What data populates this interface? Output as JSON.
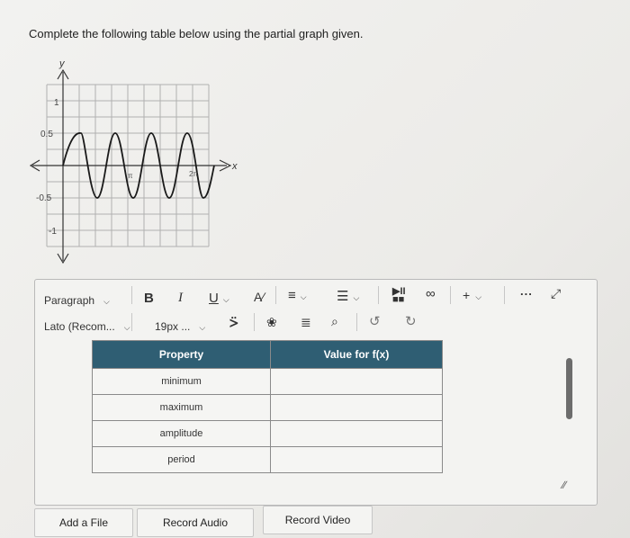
{
  "question": {
    "text": "Complete the following table below using the partial graph given."
  },
  "graph": {
    "y_axis_label": "y",
    "x_axis_label": "x",
    "tick_labels": {
      "one": "1",
      "half": "0.5",
      "neg_half": "-0.5",
      "neg_one": "-1",
      "pi": "π",
      "two_pi": "2π"
    },
    "curve_color": "#1a1a1a",
    "grid_color": "#b0b0b0"
  },
  "toolbar": {
    "paragraph_label": "Paragraph",
    "font_label": "Lato (Recom...",
    "size_label": "19px ...",
    "bold": "B",
    "italic": "I",
    "underline": "U",
    "plus": "+",
    "more": "..."
  },
  "table": {
    "headers": [
      "Property",
      "Value for f(x)"
    ],
    "rows": [
      "minimum",
      "maximum",
      "amplitude",
      "period"
    ]
  },
  "buttons": {
    "add_file": "Add a File",
    "record_audio": "Record Audio",
    "record_video": "Record Video"
  },
  "colors": {
    "table_header": "#2f5e73"
  }
}
